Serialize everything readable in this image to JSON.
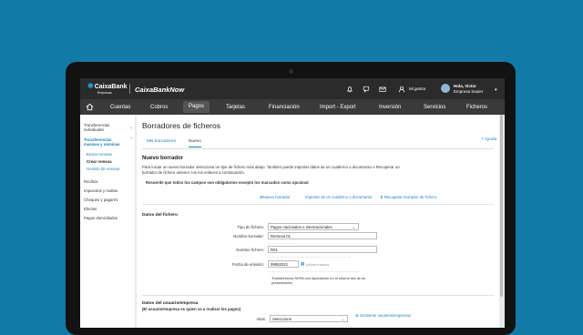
{
  "brand": {
    "logo_name": "CaixaBank",
    "logo_sub": "Empresas",
    "app_name": "CaixaBankNow"
  },
  "topbar": {
    "icons": [
      "bell-icon",
      "message-icon",
      "mail-icon",
      "manager-icon"
    ],
    "manager_label": "Mi gestor",
    "user_name": "Hola, Victor",
    "user_company": "Empresa Sauler"
  },
  "nav": {
    "items": [
      "Cuentas",
      "Cobros",
      "Pagos",
      "Tarjetas",
      "Financiación",
      "Import - Export",
      "Inversión",
      "Servicios",
      "Ficheros"
    ],
    "active": "Pagos"
  },
  "sidebar": {
    "items": [
      {
        "label": "Transferencias individuales"
      },
      {
        "label": "Transferencias masivas y nóminas"
      },
      {
        "label": "Enviar remesa"
      },
      {
        "label": "Crear remesa"
      },
      {
        "label": "Gestión de remesa"
      },
      {
        "label": "Recibos"
      },
      {
        "label": "Impuestos y multas"
      },
      {
        "label": "Cheques y pagarés"
      },
      {
        "label": "Efectos"
      },
      {
        "label": "Pagos domiciliados"
      }
    ]
  },
  "page": {
    "title": "Borradores de ficheros",
    "tabs": [
      "Mis borradores",
      "Nuevo"
    ],
    "active_tab": "Nuevo",
    "help": "Ayuda"
  },
  "nuevo": {
    "heading": "Nuevo borrador",
    "intro": "Para iniciar un nuevo borrador selecciona un tipo de fichero más abajo. También puede importar datos de un cuaderno o documento o Recuperar un borrador de fichero anterior con los enlaces a continuación.",
    "required_note": "Recuerde que todos los campos son obligatorios excepto los marcados como opcional",
    "links": [
      "Nuevo borrador",
      "Importar de un cuaderno o documento",
      "Recuperar borrador de fichero"
    ]
  },
  "datos_fichero": {
    "heading": "Datos del fichero",
    "tipo_label": "Tipo de fichero:",
    "tipo_value": "Pagos nacionales e internacionales",
    "nombre_borrador_label": "Nombre borrador:",
    "nombre_borrador_value": "Remesa 01",
    "nombre_fichero_label": "Nombre fichero:",
    "nombre_fichero_value": "R01",
    "fecha_label": "Fecha de emisión:",
    "fecha_value": "09062021",
    "fecha_format": "(dd/mm/aaaa)",
    "transfer_option": "Transferencia SEPA con liquidación en el mismo día de su presentación"
  },
  "datos_usuario": {
    "heading": "Datos del usuario/empresa",
    "subheading": "(El usuario/empresa es quien va a realizar los pagos)",
    "alias_label": "Alias:",
    "alias_value": "Seleccione",
    "manage_link": "Gestionar usuarios/empresas"
  }
}
